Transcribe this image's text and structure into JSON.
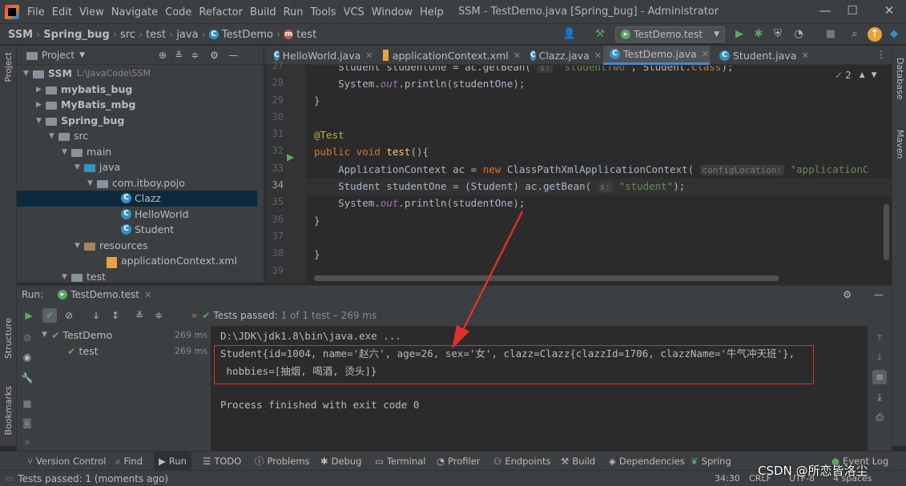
{
  "app": {
    "menu": [
      "File",
      "Edit",
      "View",
      "Navigate",
      "Code",
      "Refactor",
      "Build",
      "Run",
      "Tools",
      "VCS",
      "Window",
      "Help"
    ],
    "window_title": "SSM - TestDemo.java [Spring_bug] - Administrator"
  },
  "breadcrumbs": [
    "SSM",
    "Spring_bug",
    "src",
    "test",
    "java",
    "TestDemo",
    "test"
  ],
  "run_config": "TestDemo.test",
  "project_panel": {
    "title": "Project",
    "tree": [
      {
        "label": "SSM",
        "path": "L:\\JavaCode\\SSM",
        "bold": true
      },
      {
        "label": "mybatis_bug",
        "bold": true
      },
      {
        "label": "MyBatis_mbg",
        "bold": true
      },
      {
        "label": "Spring_bug",
        "bold": true
      },
      {
        "label": "src"
      },
      {
        "label": "main"
      },
      {
        "label": "java"
      },
      {
        "label": "com.itboy.pojo"
      },
      {
        "label": "Clazz",
        "selected": true
      },
      {
        "label": "HelloWorld"
      },
      {
        "label": "Student"
      },
      {
        "label": "resources"
      },
      {
        "label": "applicationContext.xml"
      },
      {
        "label": "test"
      }
    ]
  },
  "editor": {
    "tabs": [
      {
        "label": "HelloWorld.java"
      },
      {
        "label": "applicationContext.xml"
      },
      {
        "label": "Clazz.java"
      },
      {
        "label": "TestDemo.java",
        "active": true
      },
      {
        "label": "Student.java"
      }
    ],
    "inspection_count": "2",
    "line_numbers": [
      "27",
      "28",
      "29",
      "30",
      "31",
      "32",
      "33",
      "34",
      "35",
      "36",
      "37",
      "38",
      "39"
    ],
    "current_line": "34"
  },
  "run_panel": {
    "label": "Run:",
    "tab": "TestDemo.test",
    "status": "Tests passed:",
    "status_detail": "1 of 1 test – 269 ms",
    "tests": [
      {
        "name": "TestDemo",
        "time": "269 ms"
      },
      {
        "name": "test",
        "time": "269 ms"
      }
    ],
    "console": [
      "D:\\JDK\\jdk1.8\\bin\\java.exe ...",
      "Student{id=1004, name='赵六', age=26, sex='女', clazz=Clazz{clazzId=1706, clazzName='牛气冲天班'},",
      " hobbies=[抽烟, 喝酒, 烫头]}",
      "",
      "Process finished with exit code 0"
    ]
  },
  "bottom_tabs": [
    "Version Control",
    "Find",
    "Run",
    "TODO",
    "Problems",
    "Debug",
    "Terminal",
    "Profiler",
    "Endpoints",
    "Build",
    "Dependencies",
    "Spring",
    "Event Log"
  ],
  "side_tabs": {
    "left_top": "Project",
    "left_mid": "Structure",
    "left_bottom": "Bookmarks",
    "right_top": "Database",
    "right_mid": "Maven"
  },
  "status_bar": {
    "message": "Tests passed: 1 (moments ago)",
    "position": "34:30",
    "line_sep": "CRLF",
    "encoding": "UTF-8",
    "indent": "4 spaces"
  },
  "watermark": "CSDN @所恋皆洛尘"
}
